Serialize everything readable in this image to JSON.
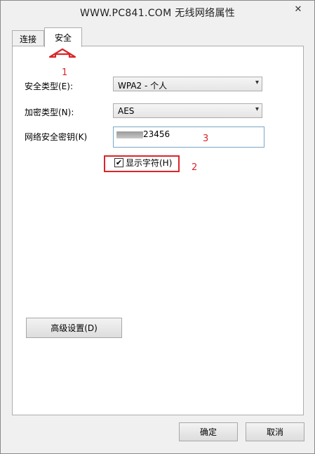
{
  "window": {
    "title": "WWW.PC841.COM 无线网络属性",
    "close_symbol": "✕"
  },
  "tabs": [
    {
      "label": "连接",
      "active": false
    },
    {
      "label": "安全",
      "active": true
    }
  ],
  "form": {
    "security_type_label": "安全类型(E):",
    "security_type_value": "WPA2 - 个人",
    "encryption_type_label": "加密类型(N):",
    "encryption_type_value": "AES",
    "network_key_label": "网络安全密钥(K)",
    "network_key_value": "23456",
    "show_characters_label": "显示字符(H)",
    "show_characters_checked": true
  },
  "buttons": {
    "advanced": "高级设置(D)",
    "ok": "确定",
    "cancel": "取消"
  },
  "annotations": {
    "n1": "1",
    "n2": "2",
    "n3": "3",
    "color": "#d9252a"
  },
  "icons": {
    "close": "close-icon",
    "dropdown": "chevron-down-icon",
    "checkmark": "checkmark-icon",
    "arrow": "up-arrow-annotation-icon"
  }
}
